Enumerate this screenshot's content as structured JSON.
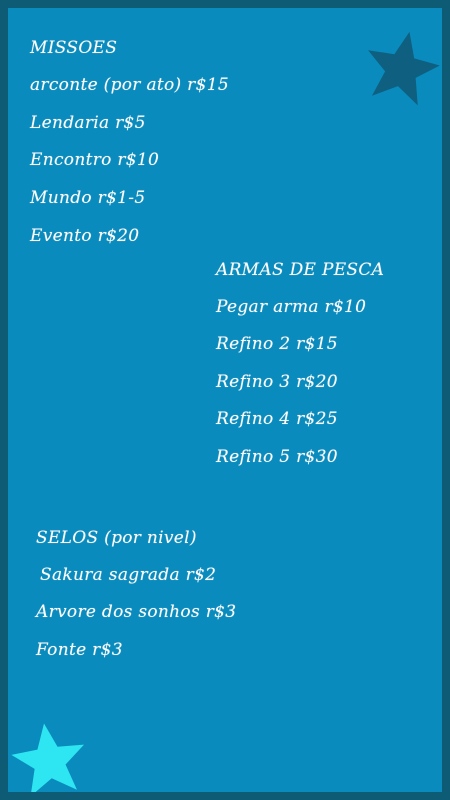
{
  "colors": {
    "background": "#0a8bbd",
    "border": "#0e5b76",
    "text": "#ffffff",
    "star_dark": "#0f5f80",
    "star_light": "#2ee6f2"
  },
  "icons": {
    "top_right": "star-icon",
    "bottom_left": "star-icon"
  },
  "missoes": {
    "heading": "MISSOES",
    "items": [
      "arconte (por ato) r$15",
      "Lendaria r$5",
      "Encontro r$10",
      "Mundo r$1-5",
      "Evento r$20"
    ]
  },
  "armas": {
    "heading": "ARMAS DE PESCA",
    "items": [
      "Pegar arma r$10",
      "Refino 2 r$15",
      "Refino 3 r$20",
      "Refino 4 r$25",
      "Refino 5 r$30"
    ]
  },
  "selos": {
    "heading": "SELOS (por nivel)",
    "items": [
      "Sakura sagrada r$2",
      "Arvore dos sonhos r$3",
      "Fonte r$3"
    ]
  }
}
